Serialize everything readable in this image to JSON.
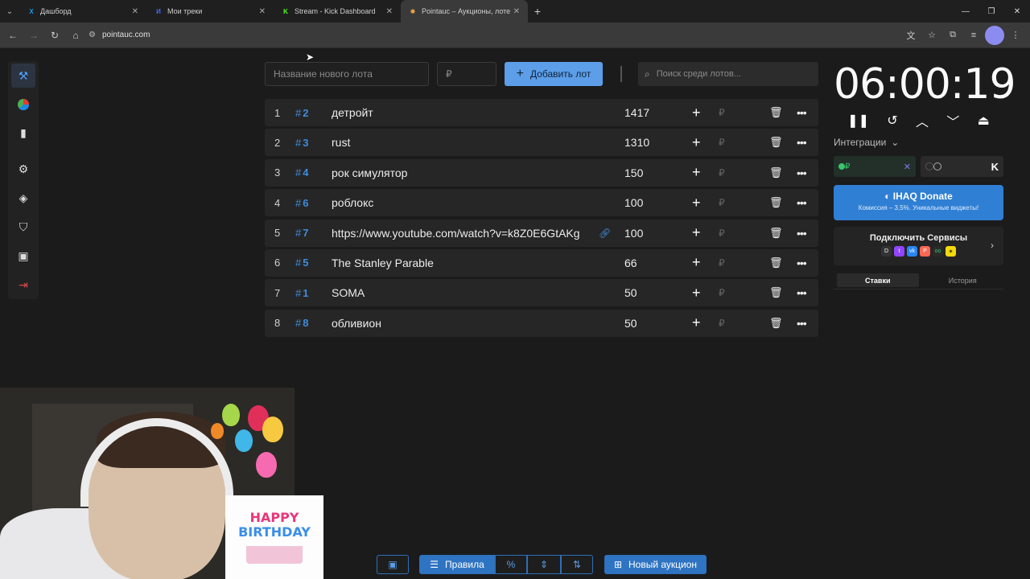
{
  "browser": {
    "tabs": [
      {
        "title": "Дашборд",
        "fav": "X",
        "fav_color": "#1d9bf0",
        "active": false
      },
      {
        "title": "Мои треки",
        "fav": "И",
        "fav_color": "#3f6ff2",
        "active": false
      },
      {
        "title": "Stream - Kick Dashboard",
        "fav": "K",
        "fav_color": "#53fc18",
        "active": false
      },
      {
        "title": "Pointauc – Аукционы, лотерея",
        "fav": "✸",
        "fav_color": "#e8a040",
        "active": true
      }
    ],
    "url": "pointauc.com"
  },
  "toolbar": {
    "name_placeholder": "Название нового лота",
    "amount_placeholder": "₽",
    "add_label": "Добавить лот",
    "search_placeholder": "Поиск среди лотов..."
  },
  "lots": [
    {
      "idx": "1",
      "num": "2",
      "name": "детройт",
      "amount": "1417",
      "link": false
    },
    {
      "idx": "2",
      "num": "3",
      "name": "rust",
      "amount": "1310",
      "link": false
    },
    {
      "idx": "3",
      "num": "4",
      "name": "рок симулятор",
      "amount": "150",
      "link": false
    },
    {
      "idx": "4",
      "num": "6",
      "name": "роблокс",
      "amount": "100",
      "link": false
    },
    {
      "idx": "5",
      "num": "7",
      "name": "https://www.youtube.com/watch?v=k8Z0E6GtAKg",
      "amount": "100",
      "link": true
    },
    {
      "idx": "6",
      "num": "5",
      "name": "The Stanley Parable",
      "amount": "66",
      "link": false
    },
    {
      "idx": "7",
      "num": "1",
      "name": "SOMA",
      "amount": "50",
      "link": false
    },
    {
      "idx": "8",
      "num": "8",
      "name": "обливион",
      "amount": "50",
      "link": false
    }
  ],
  "currency_symbol": "₽",
  "timer": "06:00:19",
  "integrations": {
    "label": "Интеграции",
    "donate_title": "IHAQ Donate",
    "donate_sub": "Комиссия – 3,5%. Уникальные виджеты!",
    "connect_title": "Подключить Сервисы"
  },
  "history_tabs": {
    "bids": "Ставки",
    "history": "История"
  },
  "bottom": {
    "rules": "Правила",
    "new_auction": "Новый аукцион"
  },
  "birthday": {
    "line1": "HAPPY",
    "line2": "BIRTHDAY"
  }
}
